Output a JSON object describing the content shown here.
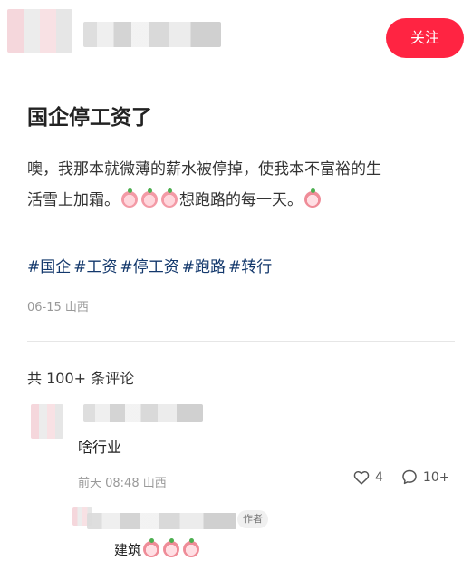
{
  "header": {
    "follow_label": "关注"
  },
  "post": {
    "title": "国企停工资了",
    "body_line1": "噢，我那本就微薄的薪水被停掉，使我本不富裕的生",
    "body_line2_a": "活雪上加霜。",
    "body_line2_b": "想跑路的每一天。",
    "tags": [
      "#国企",
      "#工资",
      "#停工资",
      "#跑路",
      "#转行"
    ],
    "meta": "06-15 山西"
  },
  "comments_section": {
    "count_label": "共 100+ 条评论"
  },
  "comment_1": {
    "text": "啥行业",
    "meta": "前天 08:48 山西",
    "likes": "4",
    "replies": "10+"
  },
  "reply_1": {
    "author_badge": "作者",
    "text": "建筑"
  },
  "colors": {
    "accent": "#ff2442",
    "tag": "#13386c",
    "meta": "#999999"
  },
  "icons": {
    "like": "heart-icon",
    "comment": "comment-bubble-icon"
  }
}
